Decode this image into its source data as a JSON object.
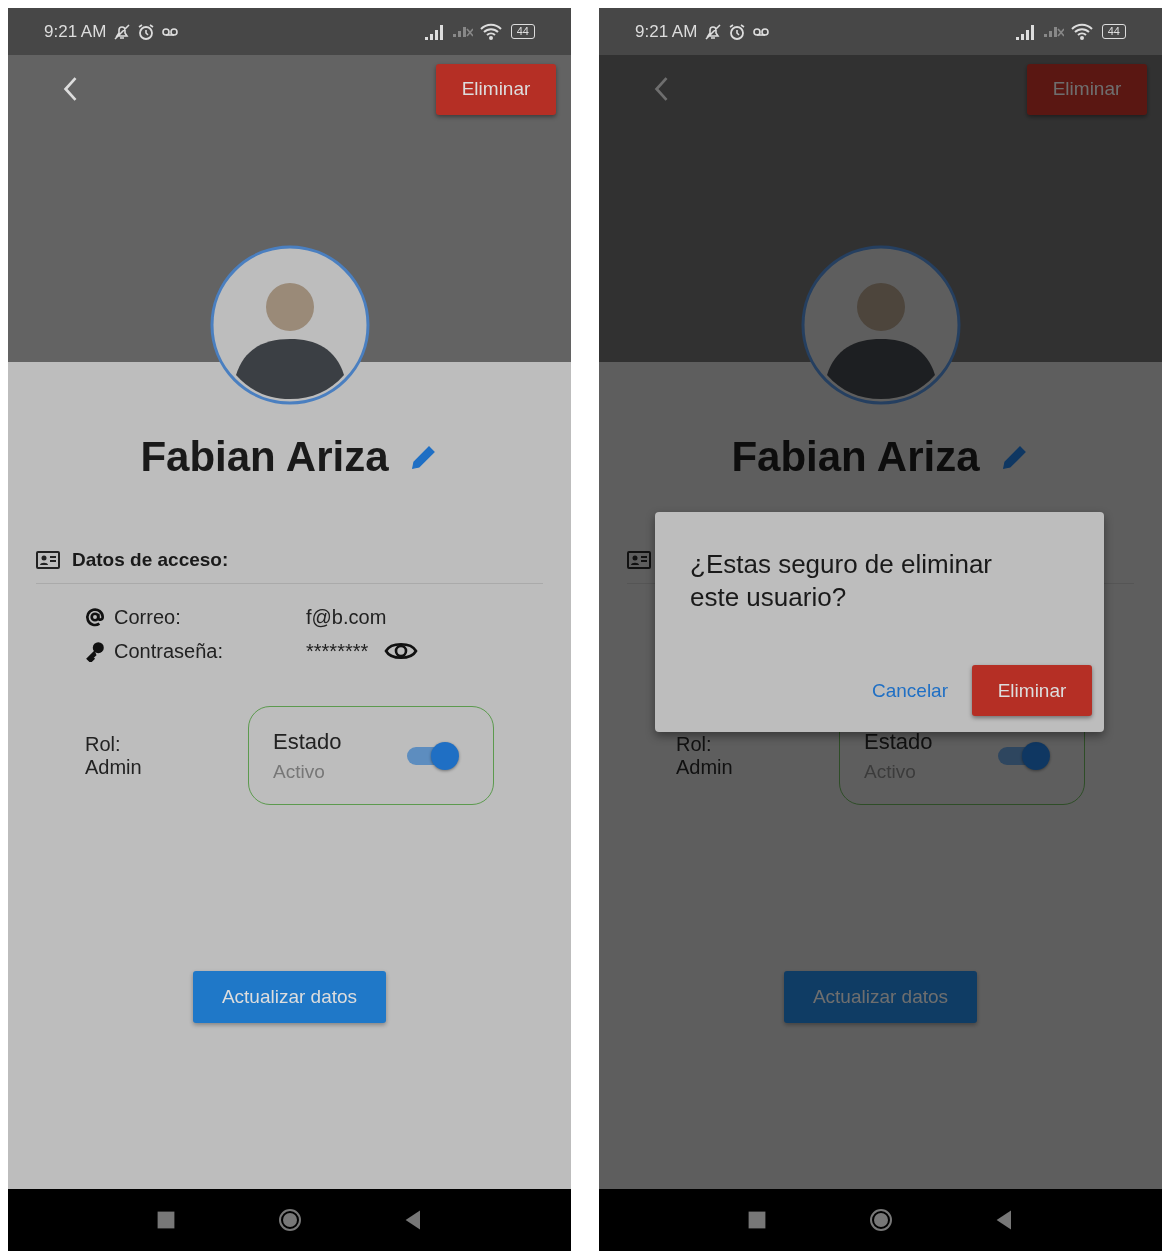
{
  "screens": [
    {
      "status_bar": {
        "time": "9:21 AM",
        "battery": "44"
      },
      "delete_button": "Eliminar",
      "user_name": "Fabian Ariza",
      "section_title": "Datos de acceso:",
      "fields": [
        {
          "kind": "email",
          "label": "Correo:",
          "value": "f@b.com"
        },
        {
          "kind": "password",
          "label": "Contraseña:",
          "value": "********"
        }
      ],
      "role": {
        "label": "Rol:",
        "value": "Admin"
      },
      "status": {
        "title": "Estado",
        "value": "Activo",
        "on": true
      },
      "update_button": "Actualizar datos"
    },
    {
      "status_bar": {
        "time": "9:21 AM",
        "battery": "44"
      },
      "delete_button": "Eliminar",
      "user_name": "Fabian Ariza",
      "role": {
        "label": "Rol:",
        "value": "Admin"
      },
      "status": {
        "title": "Estado",
        "value": "Activo",
        "on": true
      },
      "update_button": "Actualizar datos",
      "dialog": {
        "message": "¿Estas seguro de eliminar este usuario?",
        "cancel_button": "Cancelar",
        "confirm_button": "Eliminar"
      }
    }
  ]
}
